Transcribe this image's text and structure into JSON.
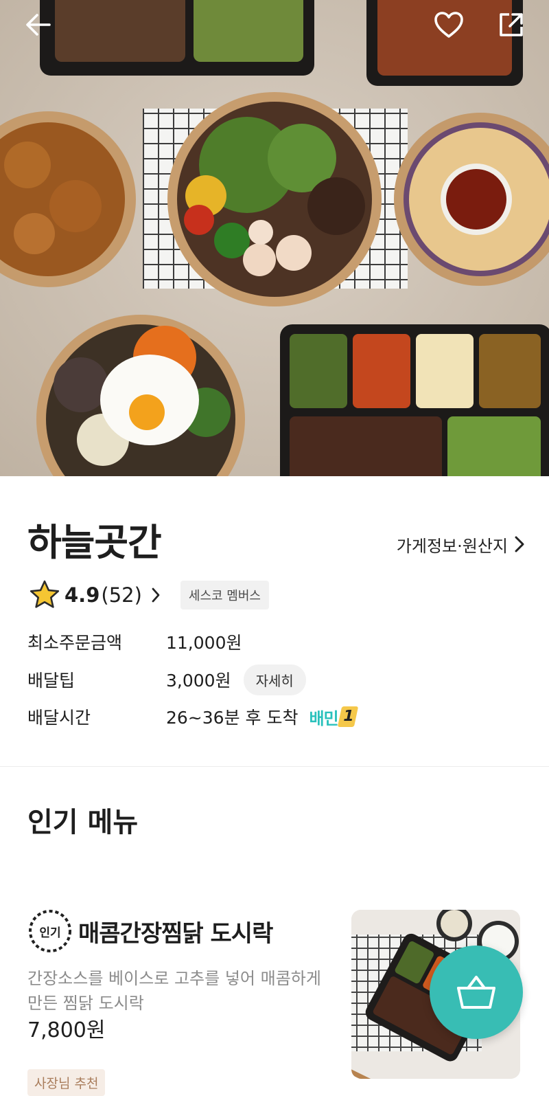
{
  "header": {
    "back_icon": "arrow-left-icon",
    "like_icon": "heart-outline-icon",
    "share_icon": "share-external-icon"
  },
  "store": {
    "name": "하늘곳간",
    "info_link": "가게정보·원산지",
    "rating": "4.9",
    "review_count": "(52)",
    "member_badge": "세스코 멤버스",
    "min_order_label": "최소주문금액",
    "min_order_value": "11,000원",
    "delivery_tip_label": "배달팁",
    "delivery_tip_value": "3,000원",
    "detail_button": "자세히",
    "delivery_time_label": "배달시간",
    "delivery_time_value": "26~36분 후 도착",
    "delivery_brand": "배민",
    "delivery_brand_number": "1"
  },
  "popular": {
    "title": "인기 메뉴",
    "items": [
      {
        "badge": "인기",
        "name": "매콤간장찜닭 도시락",
        "description": "간장소스를 베이스로 고추를 넣어 매콤하게 만든 찜닭 도시락",
        "price": "7,800원",
        "tag": "사장님 추천"
      }
    ]
  },
  "cart": {
    "icon": "basket-icon"
  },
  "colors": {
    "accent": "#38bdb4",
    "brand_teal": "#2ac1bc",
    "owner_pick_text": "#a97d5c",
    "owner_pick_bg": "#f6ede6"
  }
}
